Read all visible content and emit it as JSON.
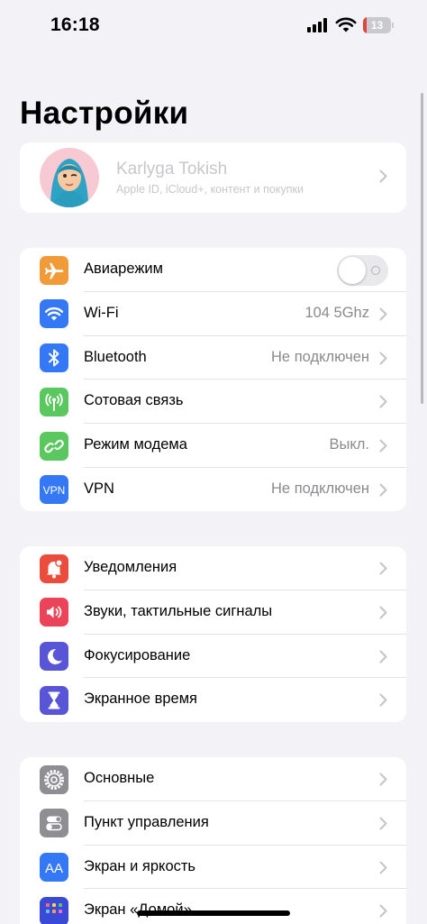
{
  "status_bar": {
    "time": "16:18",
    "battery": "13",
    "battery_level": 0.13
  },
  "title": "Настройки",
  "profile": {
    "name": "Karlyga Tokish",
    "subtitle": "Apple ID, iCloud+, контент и покупки"
  },
  "group1": [
    {
      "label": "Авиарежим",
      "icon": "airplane-icon",
      "color": "#f19a38",
      "toggle": false
    },
    {
      "label": "Wi-Fi",
      "value": "104 5Ghz",
      "icon": "wifi-icon",
      "color": "#3478f6"
    },
    {
      "label": "Bluetooth",
      "value": "Не подключен",
      "icon": "bluetooth-icon",
      "color": "#3478f6"
    },
    {
      "label": "Сотовая связь",
      "value": "",
      "icon": "antenna-icon",
      "color": "#5ac85f"
    },
    {
      "label": "Режим модема",
      "value": "Выкл.",
      "icon": "link-icon",
      "color": "#5ac85f"
    },
    {
      "label": "VPN",
      "value": "Не подключен",
      "icon": "vpn-icon",
      "color": "#3478f6",
      "icon_text": "VPN"
    }
  ],
  "group2": [
    {
      "label": "Уведомления",
      "icon": "bell-icon",
      "color": "#eb4d3d"
    },
    {
      "label": "Звуки, тактильные сигналы",
      "icon": "speaker-icon",
      "color": "#eb445a"
    },
    {
      "label": "Фокусирование",
      "icon": "moon-icon",
      "color": "#5856d6"
    },
    {
      "label": "Экранное время",
      "icon": "hourglass-icon",
      "color": "#5856d6"
    }
  ],
  "group3": [
    {
      "label": "Основные",
      "icon": "gear-icon",
      "color": "#8e8e93"
    },
    {
      "label": "Пункт управления",
      "icon": "toggles-icon",
      "color": "#8e8e93"
    },
    {
      "label": "Экран и яркость",
      "icon": "text-size-icon",
      "color": "#3478f6",
      "icon_text": "AA"
    },
    {
      "label": "Экран «Домой»",
      "icon": "home-grid-icon",
      "color": "#3a49d6"
    }
  ]
}
